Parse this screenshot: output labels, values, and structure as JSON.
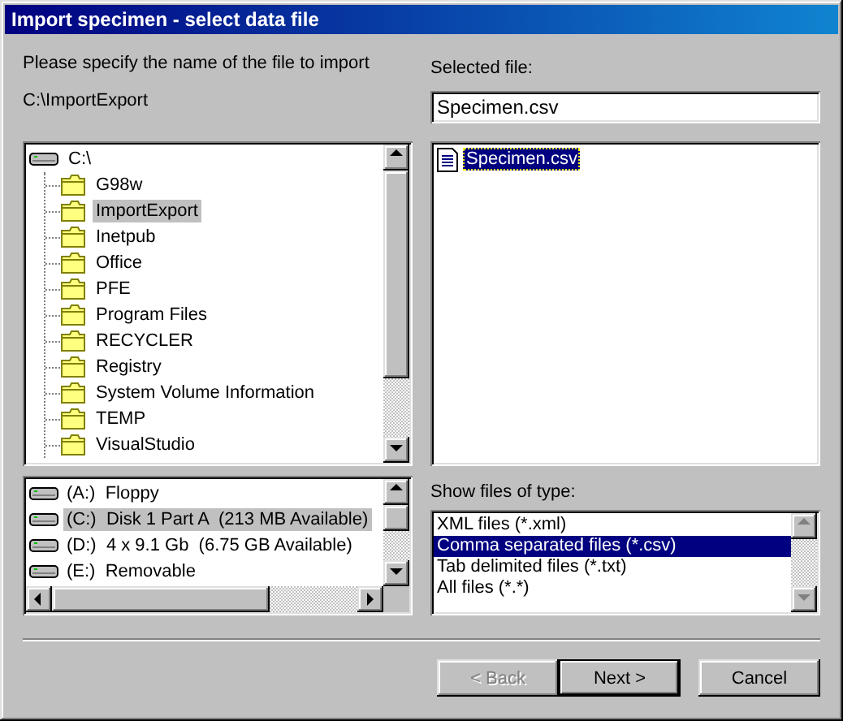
{
  "window": {
    "title": "Import specimen - select data file"
  },
  "instruction": "Please specify the name of the file to import",
  "current_path": "C:\\ImportExport",
  "folder_tree": {
    "label": "C:\\",
    "selected": false,
    "children": [
      {
        "label": "G98w",
        "selected": false
      },
      {
        "label": "ImportExport",
        "selected": true
      },
      {
        "label": "Inetpub",
        "selected": false
      },
      {
        "label": "Office",
        "selected": false
      },
      {
        "label": "PFE",
        "selected": false
      },
      {
        "label": "Program Files",
        "selected": false
      },
      {
        "label": "RECYCLER",
        "selected": false
      },
      {
        "label": "Registry",
        "selected": false
      },
      {
        "label": "System Volume Information",
        "selected": false
      },
      {
        "label": "TEMP",
        "selected": false
      },
      {
        "label": "VisualStudio",
        "selected": false
      }
    ]
  },
  "drives": [
    {
      "label": "(A:)  Floppy",
      "selected": false
    },
    {
      "label": "(C:)  Disk 1 Part A  (213 MB Available)",
      "selected": true
    },
    {
      "label": "(D:)  4 x 9.1 Gb  (6.75 GB Available)",
      "selected": false
    },
    {
      "label": "(E:)  Removable",
      "selected": false
    }
  ],
  "selected_file": {
    "label": "Selected file:",
    "value": "Specimen.csv"
  },
  "files": [
    {
      "name": "Specimen.csv",
      "selected": true
    }
  ],
  "file_type": {
    "label": "Show files of type:",
    "options": [
      {
        "label": "XML files (*.xml)",
        "selected": false
      },
      {
        "label": "Comma separated files (*.csv)",
        "selected": true
      },
      {
        "label": "Tab delimited files (*.txt)",
        "selected": false
      },
      {
        "label": "All files (*.*)",
        "selected": false
      }
    ]
  },
  "buttons": [
    {
      "label": "< Back",
      "disabled": true,
      "default": false
    },
    {
      "label": "Next >",
      "disabled": false,
      "default": true
    },
    {
      "label": "Cancel",
      "disabled": false,
      "default": false
    }
  ]
}
